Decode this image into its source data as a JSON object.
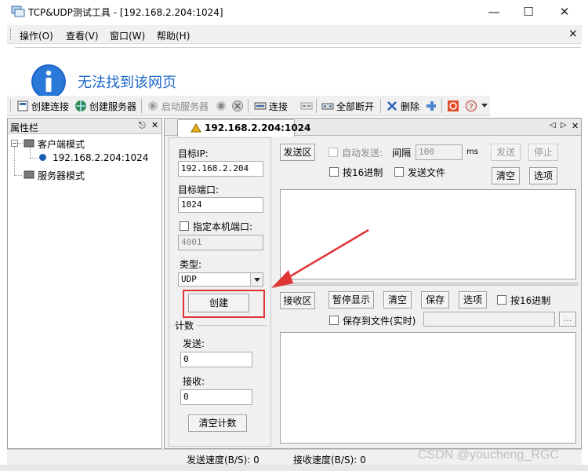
{
  "window": {
    "title": "TCP&UDP测试工具 - [192.168.2.204:1024]",
    "minimize": "—",
    "maximize": "☐",
    "close": "✕"
  },
  "menu": {
    "items": [
      "操作(O)",
      "查看(V)",
      "窗口(W)",
      "帮助(H)"
    ],
    "close": "×"
  },
  "browser_error": {
    "text": "无法找到该网页",
    "icon": "info-icon"
  },
  "toolbar": {
    "create_connection": "创建连接",
    "create_server": "创建服务器",
    "start_server": "启动服务器",
    "connect": "连接",
    "disconnect_all": "全部断开",
    "delete": "删除"
  },
  "properties": {
    "title": "属性栏",
    "pin": "ꟷ",
    "close": "✕",
    "tree": {
      "client_mode": "客户端模式",
      "connection": "192.168.2.204:1024",
      "server_mode": "服务器模式"
    }
  },
  "tab": {
    "label": "192.168.2.204:1024",
    "nav_left": "◁",
    "nav_right": "▷",
    "close": "✕"
  },
  "config": {
    "target_ip_label": "目标IP:",
    "target_ip_value": "192.168.2.204",
    "target_port_label": "目标端口:",
    "target_port_value": "1024",
    "local_port_label": "指定本机端口:",
    "local_port_value": "4001",
    "type_label": "类型:",
    "type_value": "UDP",
    "create_button": "创建",
    "count_label": "计数",
    "send_label": "发送:",
    "send_value": "0",
    "recv_label": "接收:",
    "recv_value": "0",
    "clear_count": "清空计数"
  },
  "send_area": {
    "label": "发送区",
    "auto_send": "自动发送:",
    "interval_label": "间隔",
    "interval_value": "100",
    "interval_unit": "ms",
    "send_button": "发送",
    "stop_button": "停止",
    "hex_label": "按16进制",
    "send_file_label": "发送文件",
    "clear_button": "清空",
    "options_button": "选项"
  },
  "recv_area": {
    "label": "接收区",
    "pause_button": "暂停显示",
    "clear_button": "清空",
    "save_button": "保存",
    "options_button": "选项",
    "hex_label": "按16进制",
    "save_to_file_label": "保存到文件(实时)",
    "browse": "..."
  },
  "status": {
    "send_speed": "发送速度(B/S): 0",
    "recv_speed": "接收速度(B/S): 0"
  },
  "watermark": "CSDN @youcheng_RGC",
  "colors": {
    "highlight_red": "#e03434",
    "info_blue": "#1b66c9",
    "tree_selected": "#1a5fb4"
  }
}
